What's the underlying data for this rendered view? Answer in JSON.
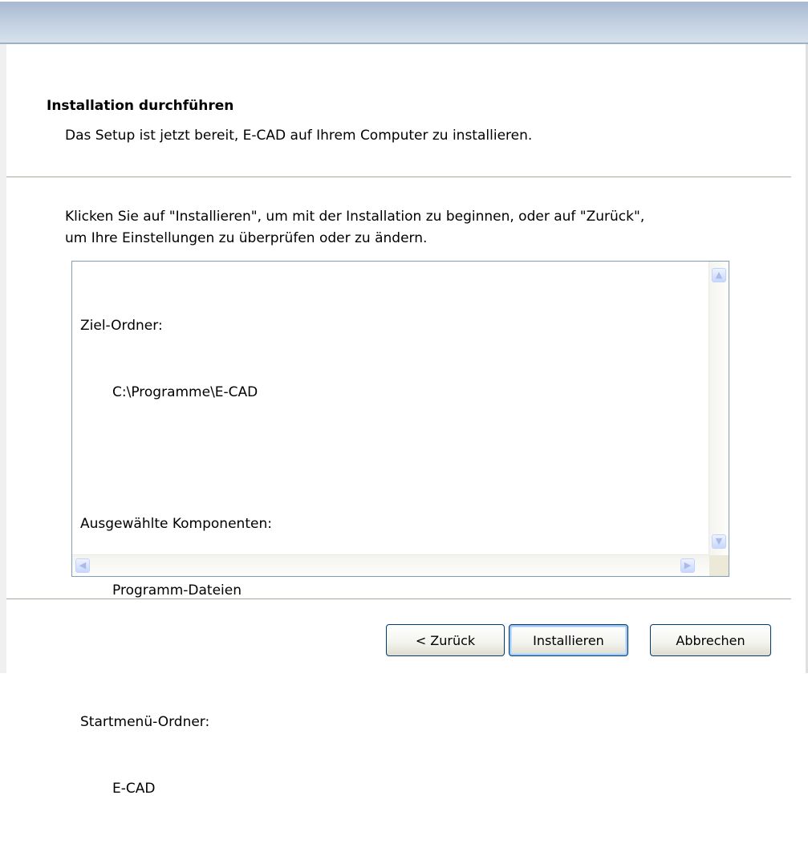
{
  "header": {
    "title": "Installation durchführen",
    "subtitle": "Das Setup ist jetzt bereit, E-CAD auf Ihrem Computer zu installieren."
  },
  "instruction": {
    "line1": "Klicken Sie auf \"Installieren\", um mit der Installation zu beginnen, oder auf \"Zurück\",",
    "line2": "um Ihre Einstellungen zu überprüfen oder zu ändern."
  },
  "summary": {
    "groups": [
      {
        "title": "Ziel-Ordner:",
        "value": "C:\\Programme\\E-CAD"
      },
      {
        "title": "Ausgewählte Komponenten:",
        "value": "Programm-Dateien"
      },
      {
        "title": "Startmenü-Ordner:",
        "value": "E-CAD"
      }
    ]
  },
  "buttons": {
    "back": "< Zurück",
    "install": "Installieren",
    "cancel": "Abbrechen"
  },
  "icons": {
    "scroll_up": "scroll-up-arrow",
    "scroll_down": "scroll-down-arrow",
    "scroll_left": "scroll-left-arrow",
    "scroll_right": "scroll-right-arrow"
  }
}
